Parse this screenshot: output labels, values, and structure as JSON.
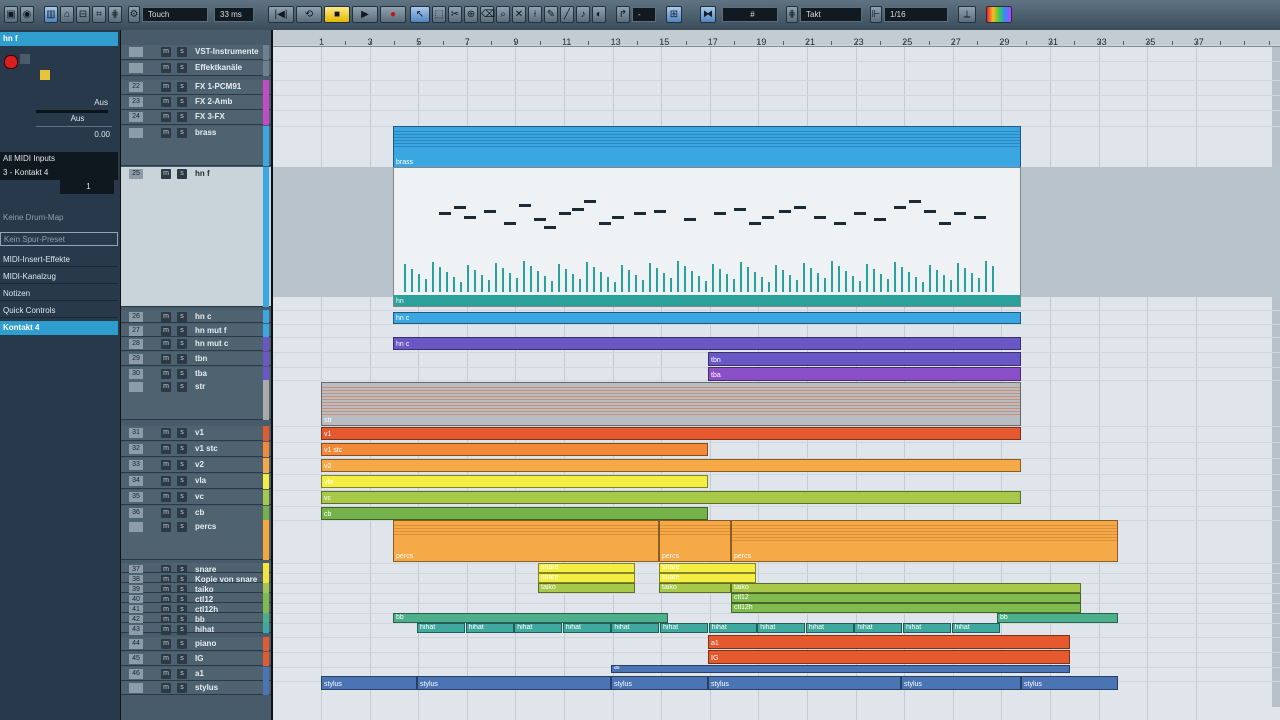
{
  "toolbar": {
    "automation_mode": "Touch",
    "latency": "33 ms",
    "snap_type": "Takt",
    "quantize": "1/16"
  },
  "inspector": {
    "track_name": "hn f",
    "volume_label": "Aus",
    "pan_label": "Aus",
    "pan_value": "0.00",
    "input": "All MIDI Inputs",
    "output": "3 - Kontakt 4",
    "channel": "1",
    "drum_map": "Keine Drum-Map",
    "preset": "Kein Spur-Preset",
    "sections": [
      "MIDI-Insert-Effekte",
      "MIDI-Kanalzug",
      "Notizen",
      "Quick Controls"
    ],
    "instrument_slot": "Kontakt 4"
  },
  "ruler": {
    "bars": [
      "1",
      "3",
      "5",
      "7",
      "9",
      "11",
      "13",
      "15",
      "17",
      "19",
      "21",
      "23",
      "25",
      "27",
      "29",
      "31",
      "33",
      "35",
      "37"
    ]
  },
  "tracks": [
    {
      "num": "",
      "name": "VST-Instrumente",
      "kind": "folder",
      "color": "#6f8190"
    },
    {
      "num": "",
      "name": "Effektkanäle",
      "kind": "folder",
      "color": "#6f8190"
    },
    {
      "num": "22",
      "name": "FX 1-PCM91",
      "color": "#c34cc4"
    },
    {
      "num": "23",
      "name": "FX 2-Amb",
      "color": "#c34cc4"
    },
    {
      "num": "24",
      "name": "FX 3-FX",
      "color": "#c34cc4"
    },
    {
      "num": "",
      "name": "brass",
      "kind": "folder",
      "color": "#3aa7e3"
    },
    {
      "num": "25",
      "name": "hn f",
      "color": "#3aa7e3"
    },
    {
      "num": "26",
      "name": "hn c",
      "color": "#3aa7e3"
    },
    {
      "num": "27",
      "name": "hn mut f",
      "color": "#3aa7e3"
    },
    {
      "num": "28",
      "name": "hn mut c",
      "color": "#6a57c6"
    },
    {
      "num": "29",
      "name": "tbn",
      "color": "#6a57c6"
    },
    {
      "num": "30",
      "name": "tba",
      "color": "#6a57c6"
    },
    {
      "num": "",
      "name": "str",
      "kind": "folder",
      "color": "#a9a9a9"
    },
    {
      "num": "31",
      "name": "v1",
      "color": "#e4592e"
    },
    {
      "num": "32",
      "name": "v1 stc",
      "color": "#f28a3a"
    },
    {
      "num": "33",
      "name": "v2",
      "color": "#f6a947"
    },
    {
      "num": "34",
      "name": "vla",
      "color": "#f4ee43"
    },
    {
      "num": "35",
      "name": "vc",
      "color": "#a8c84a"
    },
    {
      "num": "36",
      "name": "cb",
      "color": "#76b24a"
    },
    {
      "num": "",
      "name": "percs",
      "kind": "folder",
      "color": "#f3a93c"
    },
    {
      "num": "37",
      "name": "snare",
      "color": "#f4e33d"
    },
    {
      "num": "38",
      "name": "Kopie von snare",
      "color": "#f4e33d"
    },
    {
      "num": "39",
      "name": "taiko",
      "color": "#a2c64b"
    },
    {
      "num": "40",
      "name": "ctl12",
      "color": "#7fbb4d"
    },
    {
      "num": "41",
      "name": "ctl12h",
      "color": "#7fbb4d"
    },
    {
      "num": "42",
      "name": "bb",
      "color": "#4db08b"
    },
    {
      "num": "43",
      "name": "hihat",
      "color": "#3fa9a0"
    },
    {
      "num": "44",
      "name": "piano",
      "color": "#e4592e"
    },
    {
      "num": "45",
      "name": "IG",
      "color": "#e4592e"
    },
    {
      "num": "46",
      "name": "a1",
      "color": "#4a74b3"
    },
    {
      "num": "",
      "name": "stylus",
      "kind": "folder",
      "color": "#4a74b3"
    }
  ],
  "clips": {
    "brass": "brass",
    "hn_f": "hn",
    "hn_c": "hn c",
    "hn_mut_c": "hn c",
    "tbn": "tbn",
    "tba": "tba",
    "str": "str",
    "v1": "v1",
    "v1_stc": "v1 stc",
    "v2": "v2",
    "vla": "vla",
    "vc": "vc",
    "cb": "cb",
    "percs": "percs",
    "snare": "snare",
    "taiko": "taiko",
    "ctl12": "ctl12",
    "ctl12h": "ctl12h",
    "bb": "bb",
    "hihat": "hihat",
    "a1": "a1",
    "IG": "IG",
    "af": "af",
    "stylus": "stylus"
  },
  "colors": {
    "brass": "#3aa7e3",
    "violet": "#6a57c6",
    "purple": "#8a4fc6",
    "orange_red": "#e4592e",
    "orange": "#f6a947",
    "yellow": "#f4ee43",
    "green": "#a8c84a",
    "teal": "#3fa9a0",
    "stylus": "#4a74b3"
  }
}
